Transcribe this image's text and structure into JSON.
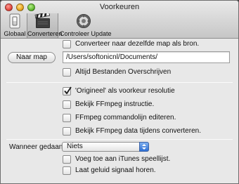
{
  "window": {
    "title": "Voorkeuren"
  },
  "toolbar": {
    "tabs": [
      {
        "label": "Globaal",
        "icon": "light-switch-icon"
      },
      {
        "label": "Converteren",
        "icon": "clapperboard-icon",
        "active": true
      },
      {
        "label": "Controleer Update",
        "icon": "gear-update-icon"
      }
    ]
  },
  "output": {
    "same_folder_label": "Converteer naar dezelfde map als bron.",
    "same_folder_checked": false,
    "choose_folder_button": "Naar map",
    "folder_path": "/Users/softonicnl/Documents/",
    "overwrite_label": "Altijd Bestanden Overschrijven",
    "overwrite_checked": false
  },
  "ffmpeg": {
    "original_resolution_label": "'Origineel' als voorkeur resolutie",
    "original_resolution_checked": true,
    "show_instruction_label": "Bekijk FFmpeg instructie.",
    "show_instruction_checked": false,
    "edit_cmdline_label": "FFmpeg commandolijn editeren.",
    "edit_cmdline_checked": false,
    "show_data_label": "Bekijk FFmpeg data tijdens converteren.",
    "show_data_checked": false
  },
  "when_done": {
    "label": "Wanneer gedaan :",
    "selected": "Niets",
    "itunes_label": "Voeg toe aan iTunes speellijst.",
    "itunes_checked": false,
    "sound_label": "Laat geluid signaal horen.",
    "sound_checked": false
  },
  "colors": {
    "checkmark": "#1a1a1a",
    "select_accent": "#3d7ee0"
  }
}
